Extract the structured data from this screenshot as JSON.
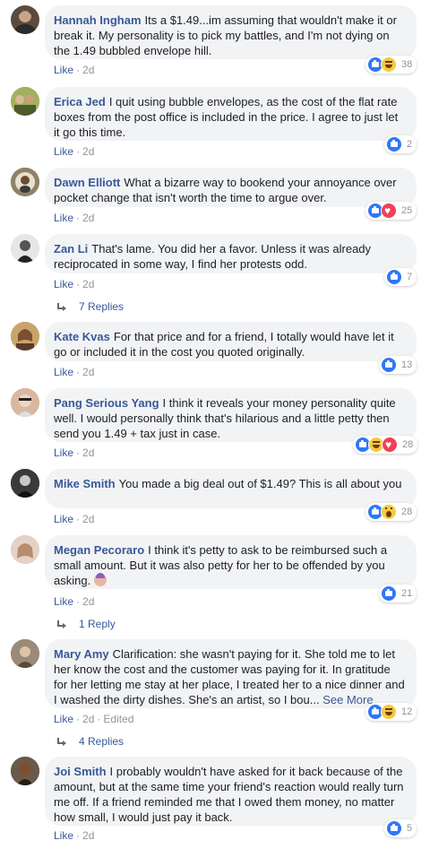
{
  "comments": [
    {
      "author": "Hannah Ingham",
      "text": "Its a $1.49...im assuming that wouldn't make it or break it. My personality is to pick my battles, and I'm not dying on the 1.49 bubbled envelope hill.",
      "like": "Like",
      "time": "2d",
      "reactions": [
        "like",
        "haha"
      ],
      "count": "38",
      "avatar_color": "#5b4a3f"
    },
    {
      "author": "Erica Jed",
      "text": "I quit using bubble envelopes, as the cost of the flat rate boxes from the post office is included in the price. I agree to just let it go this time.",
      "like": "Like",
      "time": "2d",
      "reactions": [
        "like"
      ],
      "count": "2",
      "avatar_color": "#7a8a3c"
    },
    {
      "author": "Dawn Elliott",
      "text": "What a bizarre way to bookend your annoyance over pocket change that isn't worth the time to argue over.",
      "like": "Like",
      "time": "2d",
      "reactions": [
        "like",
        "love"
      ],
      "count": "25",
      "avatar_color": "#6b5f48"
    },
    {
      "author": "Zan Li",
      "text": "That's lame. You did her a favor. Unless it was already reciprocated in some way, I find her protests odd.",
      "like": "Like",
      "time": "2d",
      "reactions": [
        "like"
      ],
      "count": "7",
      "avatar_color": "#3c3c3c",
      "replies": "7 Replies"
    },
    {
      "author": "Kate Kvas",
      "text": "For that price and for a friend, I totally would have let it go or included it in the cost you quoted originally.",
      "like": "Like",
      "time": "2d",
      "reactions": [
        "like"
      ],
      "count": "13",
      "avatar_color": "#b08850"
    },
    {
      "author": "Pang Serious Yang",
      "text": "I think it reveals your money personality quite well. I would personally think that's hilarious and a little petty then send you 1.49 + tax just in case.",
      "like": "Like",
      "time": "2d",
      "reactions": [
        "like",
        "haha",
        "love"
      ],
      "count": "28",
      "avatar_color": "#c9a184"
    },
    {
      "author": "Mike Smith",
      "text": "You made a big deal out of $1.49? This is all about you",
      "like": "Like",
      "time": "2d",
      "reactions": [
        "like",
        "wow"
      ],
      "count": "28",
      "avatar_color": "#2f2f2f"
    },
    {
      "author": "Megan Pecoraro",
      "text": "I think it's petty to ask to be reimbursed such a small amount. But it was also petty for her to be offended by you asking.",
      "like": "Like",
      "time": "2d",
      "reactions": [
        "like"
      ],
      "count": "21",
      "avatar_color": "#d6c0b3",
      "replies": "1 Reply",
      "has_emoji": true
    },
    {
      "author": "Mary Amy",
      "text": "Clarification: she wasn't paying for it. She told me to let her know the cost and the customer was paying for it. In gratitude for her letting me stay at her place, I treated her to a nice dinner and I washed the dirty dishes. She's an artist, so I bou...",
      "see_more": "See More",
      "like": "Like",
      "time": "2d",
      "edited": "Edited",
      "reactions": [
        "like",
        "haha"
      ],
      "count": "12",
      "avatar_color": "#8a7a68",
      "replies": "4 Replies"
    },
    {
      "author": "Joi Smith",
      "text": "I probably wouldn't have asked for it back because of the amount, but at the same time your friend's reaction would really turn me off. If a friend reminded me that I owed them money, no matter how small, I would just pay it back.",
      "like": "Like",
      "time": "2d",
      "reactions": [
        "like"
      ],
      "count": "5",
      "avatar_color": "#4a3a30"
    }
  ]
}
